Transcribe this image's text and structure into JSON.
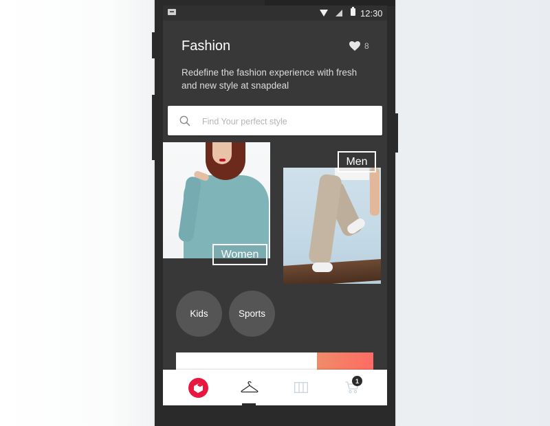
{
  "status_bar": {
    "time": "12:30",
    "icons": [
      "message-icon",
      "wifi-icon",
      "signal-icon",
      "battery-icon"
    ]
  },
  "header": {
    "title": "Fashion",
    "likes_count": "8",
    "likes_icon": "heart-icon",
    "description": "Redefine the fashion experience with fresh and new style at snapdeal"
  },
  "search": {
    "placeholder": "Find Your perfect style",
    "value": "",
    "icon": "search-icon"
  },
  "categories": {
    "cards": [
      {
        "label": "Women"
      },
      {
        "label": "Men"
      }
    ],
    "chips": [
      {
        "label": "Kids"
      },
      {
        "label": "Sports"
      }
    ]
  },
  "banner": {
    "accent_color": "#ff6b63"
  },
  "bottom_nav": {
    "items": [
      {
        "name": "home",
        "icon": "snapdeal-logo-icon",
        "active": false
      },
      {
        "name": "fashion",
        "icon": "hanger-icon",
        "active": true
      },
      {
        "name": "categories",
        "icon": "grid-columns-icon",
        "active": false
      },
      {
        "name": "cart",
        "icon": "cart-icon",
        "active": false,
        "badge": "1"
      }
    ]
  },
  "colors": {
    "brand": "#e8173f",
    "screen_bg": "#383838",
    "chip_bg": "#555555"
  }
}
